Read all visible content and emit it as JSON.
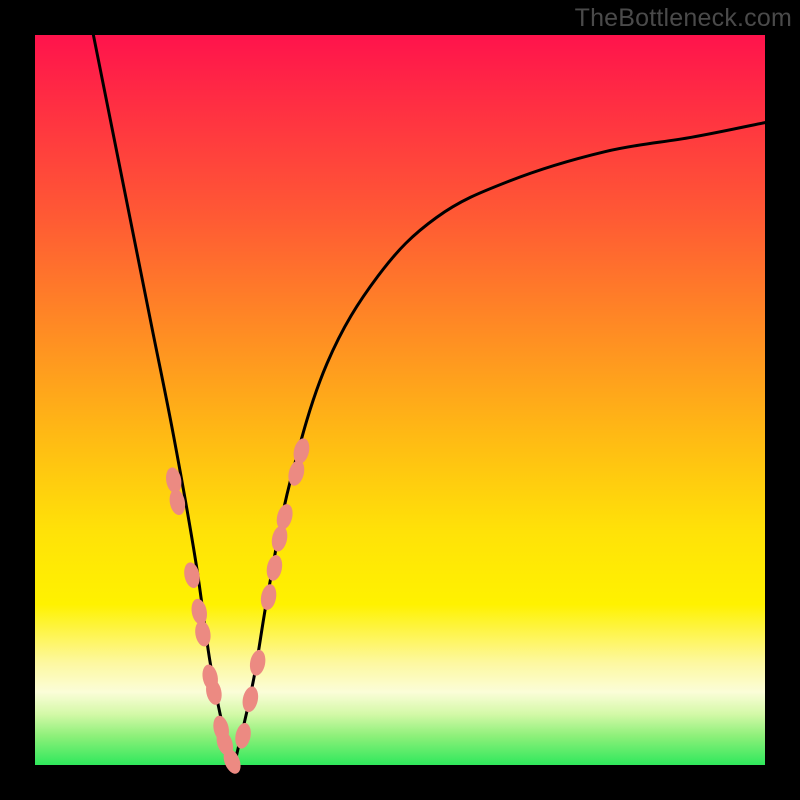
{
  "watermark": "TheBottleneck.com",
  "chart_data": {
    "type": "line",
    "title": "",
    "xlabel": "",
    "ylabel": "",
    "xlim": [
      0,
      100
    ],
    "ylim": [
      0,
      100
    ],
    "grid": false,
    "legend": false,
    "background_gradient": {
      "direction": "vertical",
      "stops": [
        {
          "pos": 0.0,
          "color": "#ff134c"
        },
        {
          "pos": 0.25,
          "color": "#ff5a34"
        },
        {
          "pos": 0.55,
          "color": "#ffba14"
        },
        {
          "pos": 0.78,
          "color": "#fff200"
        },
        {
          "pos": 0.9,
          "color": "#fbfdd8"
        },
        {
          "pos": 1.0,
          "color": "#2fe85c"
        }
      ]
    },
    "series": [
      {
        "name": "bottleneck-curve",
        "note": "V-shaped curve; minimum at x≈27 y≈0; left branch steep, right branch shallow asymptote near y≈88",
        "x": [
          8,
          10,
          13,
          16,
          19,
          22,
          24,
          26,
          27,
          28,
          30,
          32,
          35,
          40,
          47,
          55,
          65,
          78,
          90,
          100
        ],
        "y": [
          100,
          90,
          75,
          60,
          45,
          28,
          14,
          4,
          0,
          3,
          12,
          24,
          39,
          55,
          67,
          75,
          80,
          84,
          86,
          88
        ]
      },
      {
        "name": "highlight-markers-left",
        "note": "salmon short ovals along lower left branch",
        "x": [
          19.0,
          19.5,
          21.5,
          22.5,
          23.0,
          24.0,
          24.5,
          25.5,
          26.0,
          27.0
        ],
        "y": [
          39,
          36,
          26,
          21,
          18,
          12,
          10,
          5,
          3,
          0.5
        ]
      },
      {
        "name": "highlight-markers-right",
        "note": "salmon short ovals along lower right branch",
        "x": [
          28.5,
          29.5,
          30.5,
          32.0,
          32.8,
          33.5,
          34.2,
          35.8,
          36.5
        ],
        "y": [
          4,
          9,
          14,
          23,
          27,
          31,
          34,
          40,
          43
        ]
      }
    ]
  }
}
